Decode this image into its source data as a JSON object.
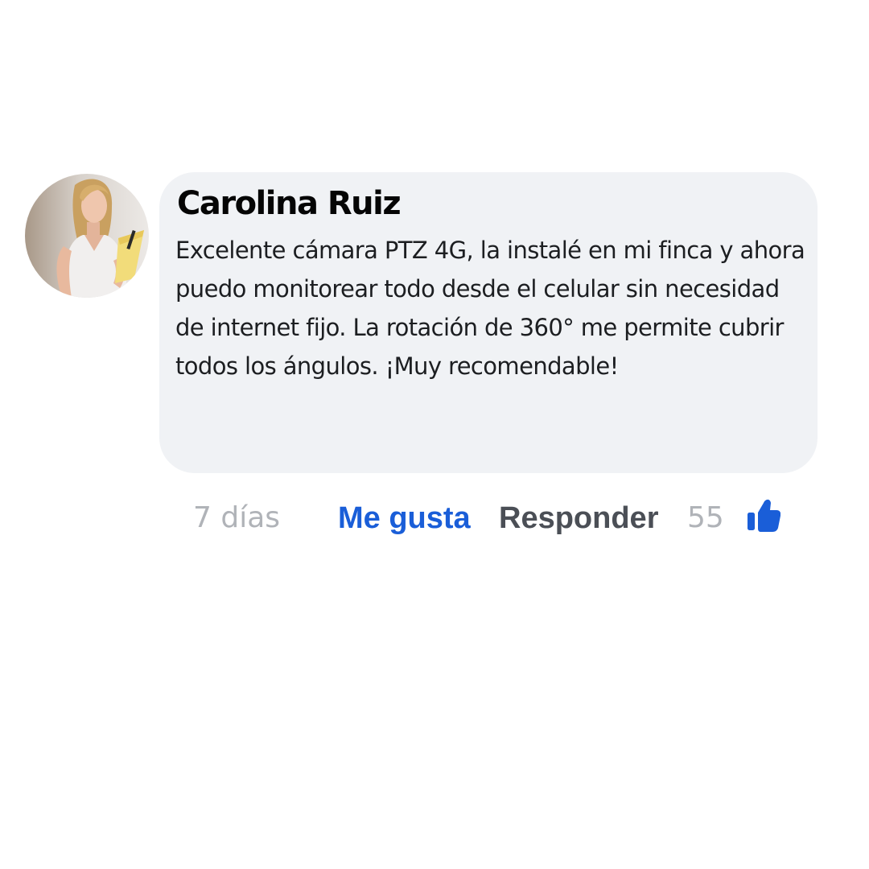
{
  "comment": {
    "author": "Carolina Ruiz",
    "avatar_alt": "avatar",
    "text": "Excelente cámara PTZ 4G, la instalé en mi finca y ahora puedo monitorear todo desde el celular sin necesidad de internet fijo. La rotación de 360° me permite cubrir todos los ángulos. ¡Muy recomendable!",
    "time": "7 días",
    "like_label": "Me gusta",
    "reply_label": "Responder",
    "like_count": "55"
  },
  "icons": {
    "like": "thumbs-up-icon"
  },
  "colors": {
    "bubble_bg": "#f0f2f5",
    "author": "#050505",
    "body_text": "#1c1e21",
    "muted": "#b0b3b8",
    "like_blue": "#1a5ed8",
    "reply_gray": "#4b4f56"
  }
}
